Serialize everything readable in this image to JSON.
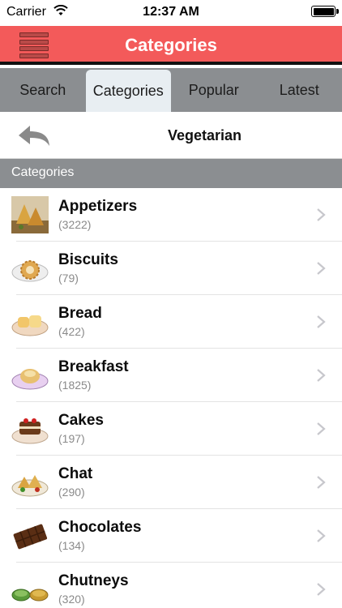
{
  "status": {
    "carrier": "Carrier",
    "time": "12:37 AM"
  },
  "nav": {
    "title": "Categories",
    "menu_icon": "menu-icon"
  },
  "tabs": [
    {
      "label": "Search",
      "active": false
    },
    {
      "label": "Categories",
      "active": true
    },
    {
      "label": "Popular",
      "active": false
    },
    {
      "label": "Latest",
      "active": false
    }
  ],
  "subheader": {
    "title": "Vegetarian",
    "back_icon": "back-arrow-icon"
  },
  "section": {
    "title": "Categories"
  },
  "categories": [
    {
      "name": "Appetizers",
      "count": "(3222)",
      "icon": "appetizers-thumb-icon"
    },
    {
      "name": "Biscuits",
      "count": "(79)",
      "icon": "biscuits-thumb-icon"
    },
    {
      "name": "Bread",
      "count": "(422)",
      "icon": "bread-thumb-icon"
    },
    {
      "name": "Breakfast",
      "count": "(1825)",
      "icon": "breakfast-thumb-icon"
    },
    {
      "name": "Cakes",
      "count": "(197)",
      "icon": "cakes-thumb-icon"
    },
    {
      "name": "Chat",
      "count": "(290)",
      "icon": "chat-thumb-icon"
    },
    {
      "name": "Chocolates",
      "count": "(134)",
      "icon": "chocolates-thumb-icon"
    },
    {
      "name": "Chutneys",
      "count": "(320)",
      "icon": "chutneys-thumb-icon"
    }
  ],
  "colors": {
    "accent": "#f35a5a",
    "tab_bar": "#8b8e91",
    "active_tab": "#e8eef2",
    "chevron": "#c7c7cc"
  }
}
